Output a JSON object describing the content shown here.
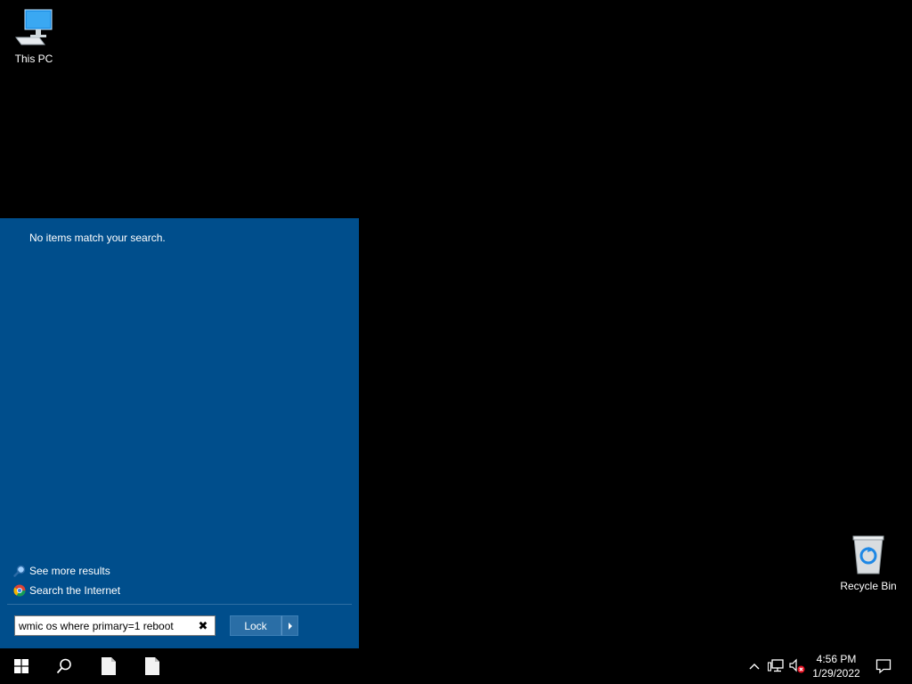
{
  "desktop": {
    "this_pc_label": "This PC",
    "recycle_bin_label": "Recycle Bin"
  },
  "start_menu": {
    "no_results_text": "No items match your search.",
    "see_more_results": "See more results",
    "search_internet": "Search the Internet",
    "search_value": "wmic os where primary=1 reboot",
    "clear_glyph": "✖",
    "lock_label": "Lock"
  },
  "taskbar": {
    "time": "4:56 PM",
    "date": "1/29/2022"
  },
  "colors": {
    "start_menu_bg": "#004e8c",
    "button_bg": "#2a6ea6"
  }
}
